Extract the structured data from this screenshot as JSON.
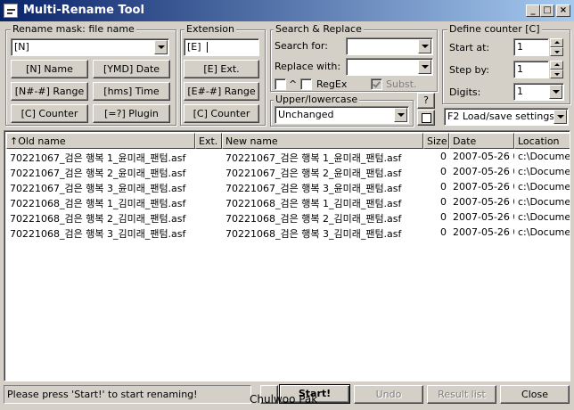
{
  "window": {
    "title": "Multi-Rename Tool"
  },
  "rename_mask": {
    "group_label": "Rename mask: file name",
    "value": "[N]",
    "buttons": [
      "[N]  Name",
      "[YMD]  Date",
      "[N#-#] Range",
      "[hms]  Time",
      "[C]  Counter",
      "[=?]  Plugin"
    ]
  },
  "extension": {
    "group_label": "Extension",
    "value": "[E]",
    "buttons": [
      "[E]  Ext.",
      "[E#-#] Range",
      "[C]  Counter"
    ]
  },
  "search_replace": {
    "group_label": "Search & Replace",
    "search_label": "Search for:",
    "search_value": "",
    "replace_label": "Replace with:",
    "replace_value": "",
    "caret_label": "^",
    "regex_label": "RegEx",
    "subst_label": "Subst."
  },
  "case": {
    "group_label": "Upper/lowercase",
    "value": "Unchanged",
    "help_label": "?"
  },
  "counter": {
    "group_label": "Define counter [C]",
    "start_label": "Start at:",
    "start_value": "1",
    "step_label": "Step by:",
    "step_value": "1",
    "digits_label": "Digits:",
    "digits_value": "1",
    "loadsave_value": "F2 Load/save settings"
  },
  "table": {
    "columns": [
      "Old name",
      "Ext.",
      "New name",
      "Size",
      "Date",
      "Location"
    ],
    "rows": [
      {
        "old": "70221067_검은 행복 1_윤미래_팬텀.asf",
        "ext": "",
        "new": "70221067_검은 행복 1_윤미래_팬텀.asf",
        "size": "0",
        "date": "2007-05-26 0...",
        "location": "c:\\Document"
      },
      {
        "old": "70221067_검은 행복 2_윤미래_팬텀.asf",
        "ext": "",
        "new": "70221067_검은 행복 2_윤미래_팬텀.asf",
        "size": "0",
        "date": "2007-05-26 0...",
        "location": "c:\\Document"
      },
      {
        "old": "70221067_검은 행복 3_윤미래_팬텀.asf",
        "ext": "",
        "new": "70221067_검은 행복 3_윤미래_팬텀.asf",
        "size": "0",
        "date": "2007-05-26 0...",
        "location": "c:\\Document"
      },
      {
        "old": "70221068_검은 행복 1_김미래_팬텀.asf",
        "ext": "",
        "new": "70221068_검은 행복 1_김미래_팬텀.asf",
        "size": "0",
        "date": "2007-05-26 0...",
        "location": "c:\\Document"
      },
      {
        "old": "70221068_검은 행복 2_김미래_팬텀.asf",
        "ext": "",
        "new": "70221068_검은 행복 2_김미래_팬텀.asf",
        "size": "0",
        "date": "2007-05-26 0...",
        "location": "c:\\Document"
      },
      {
        "old": "70221068_검은 행복 3_김미래_팬텀.asf",
        "ext": "",
        "new": "70221068_검은 행복 3_김미래_팬텀.asf",
        "size": "0",
        "date": "2007-05-26 0...",
        "location": "c:\\Document"
      }
    ]
  },
  "footer": {
    "status": "Please press 'Start!' to start renaming!",
    "start_label": "Start!",
    "undo_label": "Undo",
    "result_label": "Result list",
    "close_label": "Close",
    "watermark": "Chulwoo Pak"
  }
}
